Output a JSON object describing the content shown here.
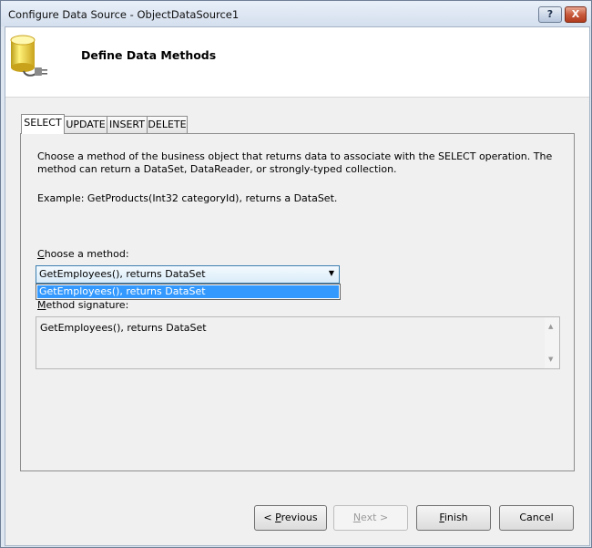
{
  "window": {
    "title": "Configure Data Source - ObjectDataSource1",
    "help_label": "?",
    "close_label": "X"
  },
  "header": {
    "title": "Define Data Methods",
    "icon": "database-plug-icon"
  },
  "tabs": [
    {
      "label": "SELECT",
      "active": true
    },
    {
      "label": "UPDATE",
      "active": false
    },
    {
      "label": "INSERT",
      "active": false
    },
    {
      "label": "DELETE",
      "active": false
    }
  ],
  "panel": {
    "description": "Choose a method of the business object that returns data to associate with the SELECT operation. The method can return a DataSet, DataReader, or strongly-typed collection.",
    "example": "Example: GetProducts(Int32 categoryId), returns a DataSet.",
    "choose_label_access": "C",
    "choose_label_rest": "hoose a method:",
    "method_select": {
      "value": "GetEmployees(), returns DataSet",
      "options": [
        "GetEmployees(), returns DataSet"
      ],
      "highlighted": "GetEmployees(), returns DataSet"
    },
    "signature_label_access": "M",
    "signature_label_rest": "ethod signature:",
    "signature_value": "GetEmployees(), returns DataSet"
  },
  "buttons": {
    "previous_prefix": "< ",
    "previous_access": "P",
    "previous_rest": "revious",
    "next_access": "N",
    "next_rest": "ext >",
    "finish_access": "F",
    "finish_rest": "inish",
    "cancel": "Cancel"
  },
  "colors": {
    "selection": "#3399ff",
    "combo_border": "#3c7fb1"
  }
}
